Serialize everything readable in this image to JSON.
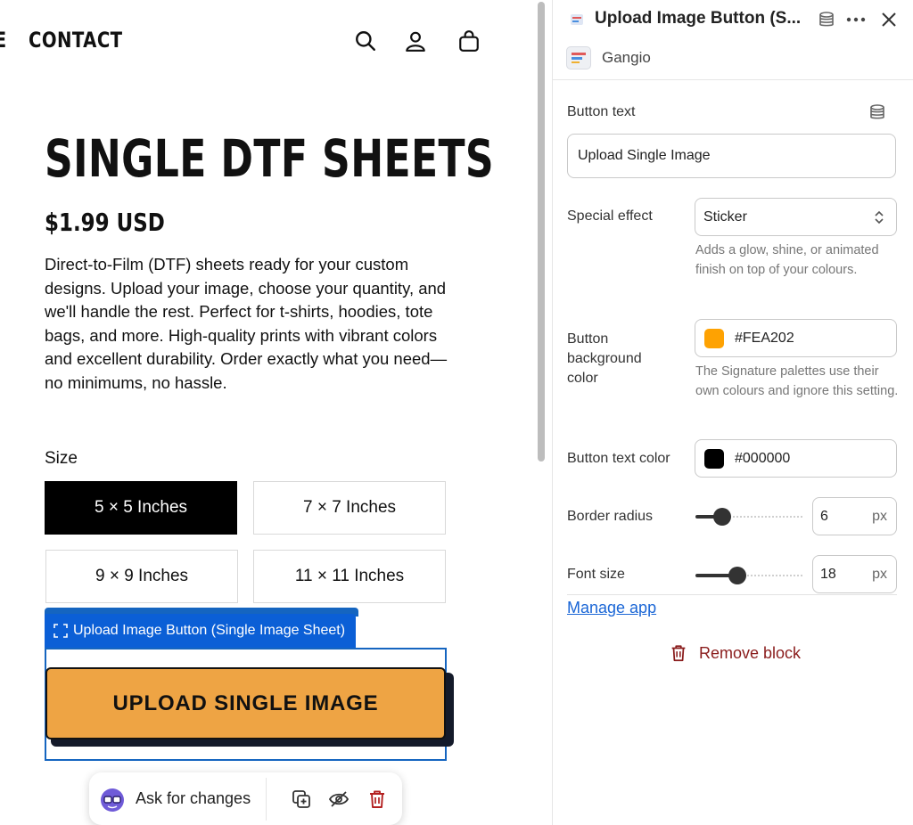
{
  "nav": {
    "partial_item": "E",
    "contact": "CONTACT"
  },
  "product": {
    "title": "SINGLE DTF SHEETS",
    "price": "$1.99 USD",
    "description": "Direct-to-Film (DTF) sheets ready for your custom designs. Upload your image, choose your quantity, and we'll handle the rest. Perfect for t-shirts, hoodies, tote bags, and more. High-quality prints with vibrant colors and excellent durability. Order exactly what you need—no minimums, no hassle.",
    "size_label": "Size",
    "sizes": [
      "5 × 5 Inches",
      "7 × 7 Inches",
      "9 × 9 Inches",
      "11 × 11 Inches"
    ],
    "selected_size": "5 × 5 Inches",
    "upload_button": "UPLOAD SINGLE IMAGE"
  },
  "editor": {
    "block_tag": "Upload Image Button (Single Image Sheet)",
    "ask_placeholder": "Ask for changes"
  },
  "panel": {
    "title": "Upload Image Button (S...",
    "app_name": "Gangio",
    "button_text_label": "Button text",
    "button_text_value": "Upload Single Image",
    "special_effect_label": "Special effect",
    "special_effect_value": "Sticker",
    "special_effect_hint": "Adds a glow, shine, or animated finish on top of your colours.",
    "bg_color_label": "Button background color",
    "bg_color_value": "#FEA202",
    "bg_color_hint": "The Signature palettes use their own colours and ignore this setting.",
    "text_color_label": "Button text color",
    "text_color_value": "#000000",
    "border_radius_label": "Border radius",
    "border_radius_value": "6",
    "border_radius_unit": "px",
    "font_size_label": "Font size",
    "font_size_value": "18",
    "font_size_unit": "px",
    "manage_app": "Manage app",
    "remove_block": "Remove block"
  },
  "colors": {
    "upload_button_bg": "#eea444",
    "swatch_bg": "#FEA202",
    "swatch_text": "#000000",
    "editor_blue": "#0b5fd6",
    "danger": "#8a1c1c",
    "link": "#1a66d6"
  },
  "icons": [
    "search-icon",
    "account-icon",
    "cart-icon",
    "select-frame-icon",
    "ai-avatar-icon",
    "duplicate-icon",
    "hide-icon",
    "trash-icon",
    "app-icon",
    "database-icon",
    "more-icon",
    "close-icon",
    "chevron-updown-icon"
  ],
  "sliders": {
    "border_radius_fraction": 0.25,
    "font_size_fraction": 0.39
  }
}
